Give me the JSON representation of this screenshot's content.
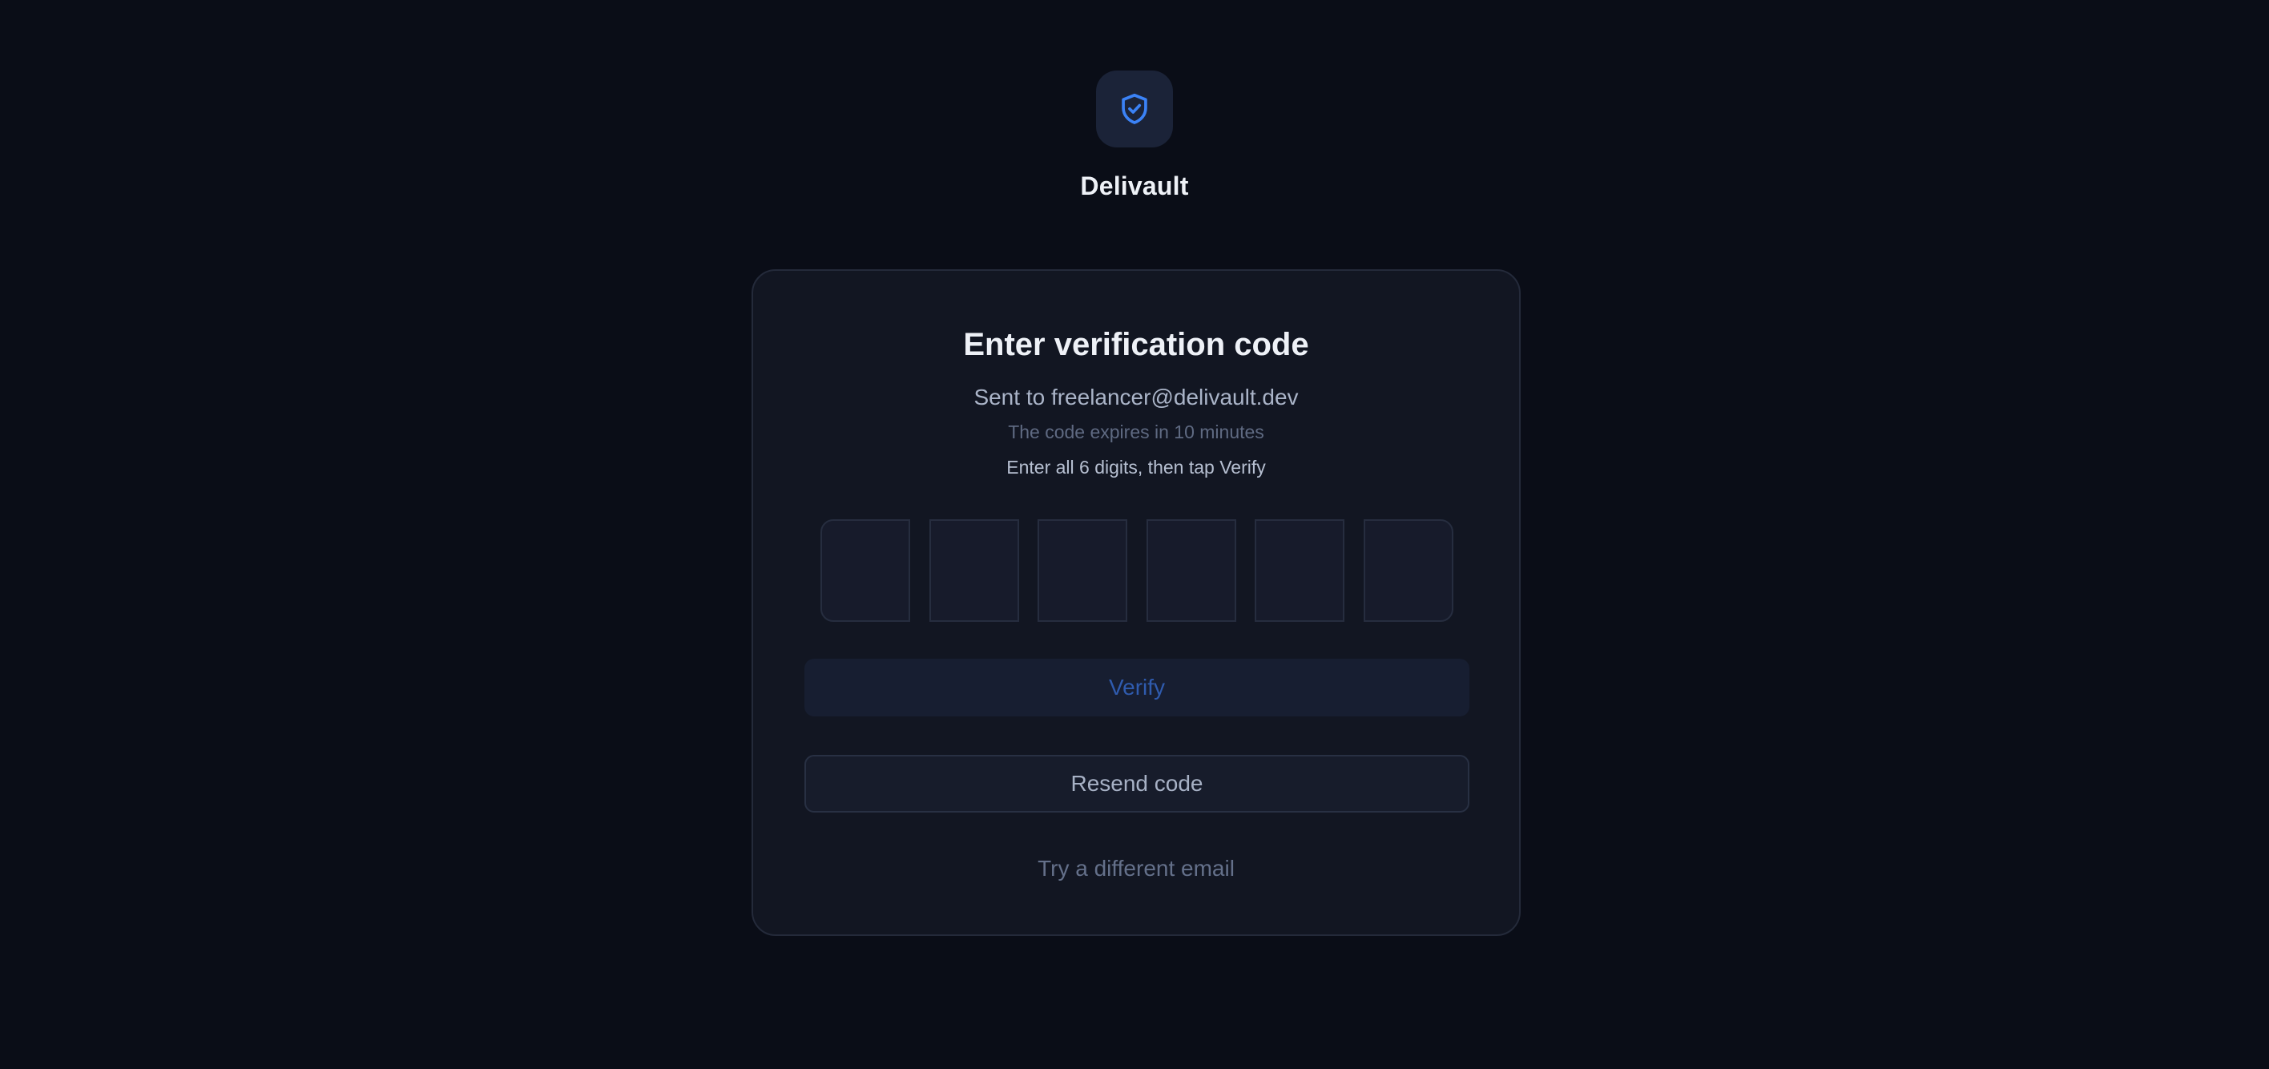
{
  "brand": {
    "name": "Delivault",
    "icon": "shield-check-icon",
    "accent_color": "#3b82f6"
  },
  "verification": {
    "title": "Enter verification code",
    "sent_to": "Sent to freelancer@delivault.dev",
    "expiry_note": "The code expires in 10 minutes",
    "instruction": "Enter all 6 digits, then tap Verify",
    "digits": [
      "",
      "",
      "",
      "",
      "",
      ""
    ],
    "verify_label": "Verify",
    "verify_disabled": true,
    "resend_label": "Resend code",
    "different_email_label": "Try a different email"
  }
}
